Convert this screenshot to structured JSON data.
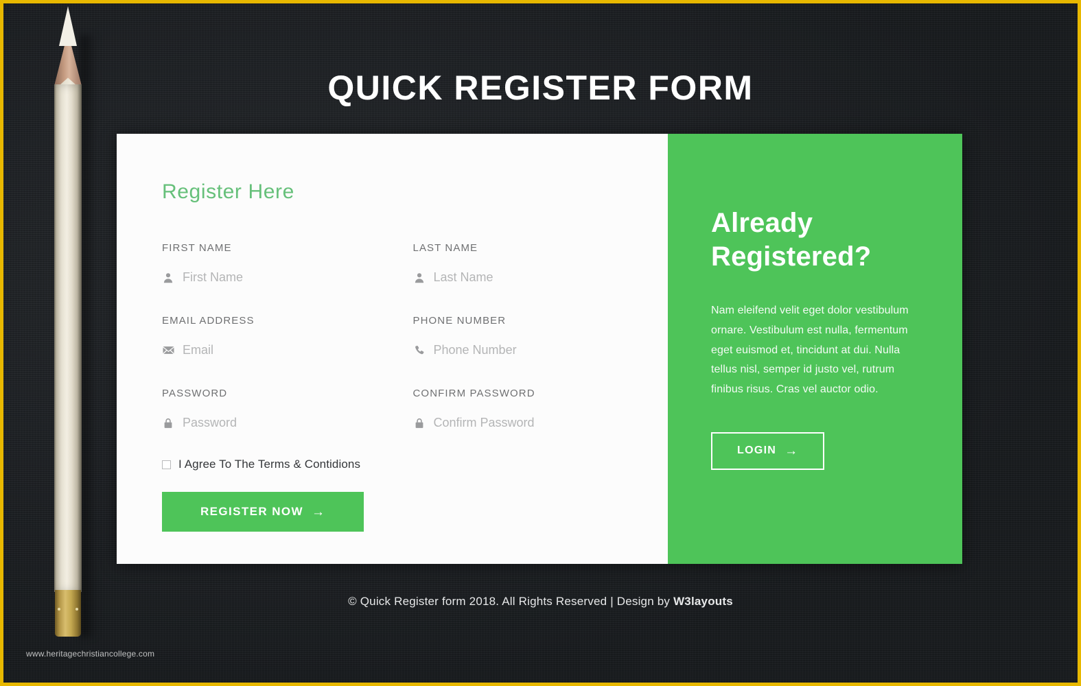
{
  "page": {
    "title": "QUICK REGISTER FORM",
    "border_color": "#e8b800",
    "background_color": "#1e2124",
    "accent_green": "#4ec459"
  },
  "decor": {
    "pencil_icon": "pencil-illustration",
    "watermark": "www.heritagechristiancollege.com"
  },
  "form": {
    "heading": "Register Here",
    "fields": [
      {
        "label": "FIRST NAME",
        "placeholder": "First Name",
        "value": "",
        "icon": "user-icon",
        "type": "text",
        "name": "first-name"
      },
      {
        "label": "LAST NAME",
        "placeholder": "Last Name",
        "value": "",
        "icon": "user-icon",
        "type": "text",
        "name": "last-name"
      },
      {
        "label": "EMAIL ADDRESS",
        "placeholder": "Email",
        "value": "",
        "icon": "email-icon",
        "type": "email",
        "name": "email"
      },
      {
        "label": "PHONE NUMBER",
        "placeholder": "Phone Number",
        "value": "",
        "icon": "phone-icon",
        "type": "tel",
        "name": "phone"
      },
      {
        "label": "PASSWORD",
        "placeholder": "Password",
        "value": "",
        "icon": "lock-icon",
        "type": "password",
        "name": "password"
      },
      {
        "label": "CONFIRM PASSWORD",
        "placeholder": "Confirm Password",
        "value": "",
        "icon": "lock-icon",
        "type": "password",
        "name": "confirm-password"
      }
    ],
    "terms_label": "I Agree To The Terms & Contidions",
    "terms_checked": false,
    "submit_label": "REGISTER NOW",
    "submit_arrow": "→"
  },
  "side": {
    "heading": "Already Registered?",
    "paragraph": "Nam eleifend velit eget dolor vestibulum ornare. Vestibulum est nulla, fermentum eget euismod et, tincidunt at dui. Nulla tellus nisl, semper id justo vel, rutrum finibus risus. Cras vel auctor odio.",
    "login_label": "LOGIN",
    "login_arrow": "→"
  },
  "footer": {
    "text": "© Quick Register form 2018. All Rights Reserved | Design by ",
    "brand": "W3layouts"
  }
}
